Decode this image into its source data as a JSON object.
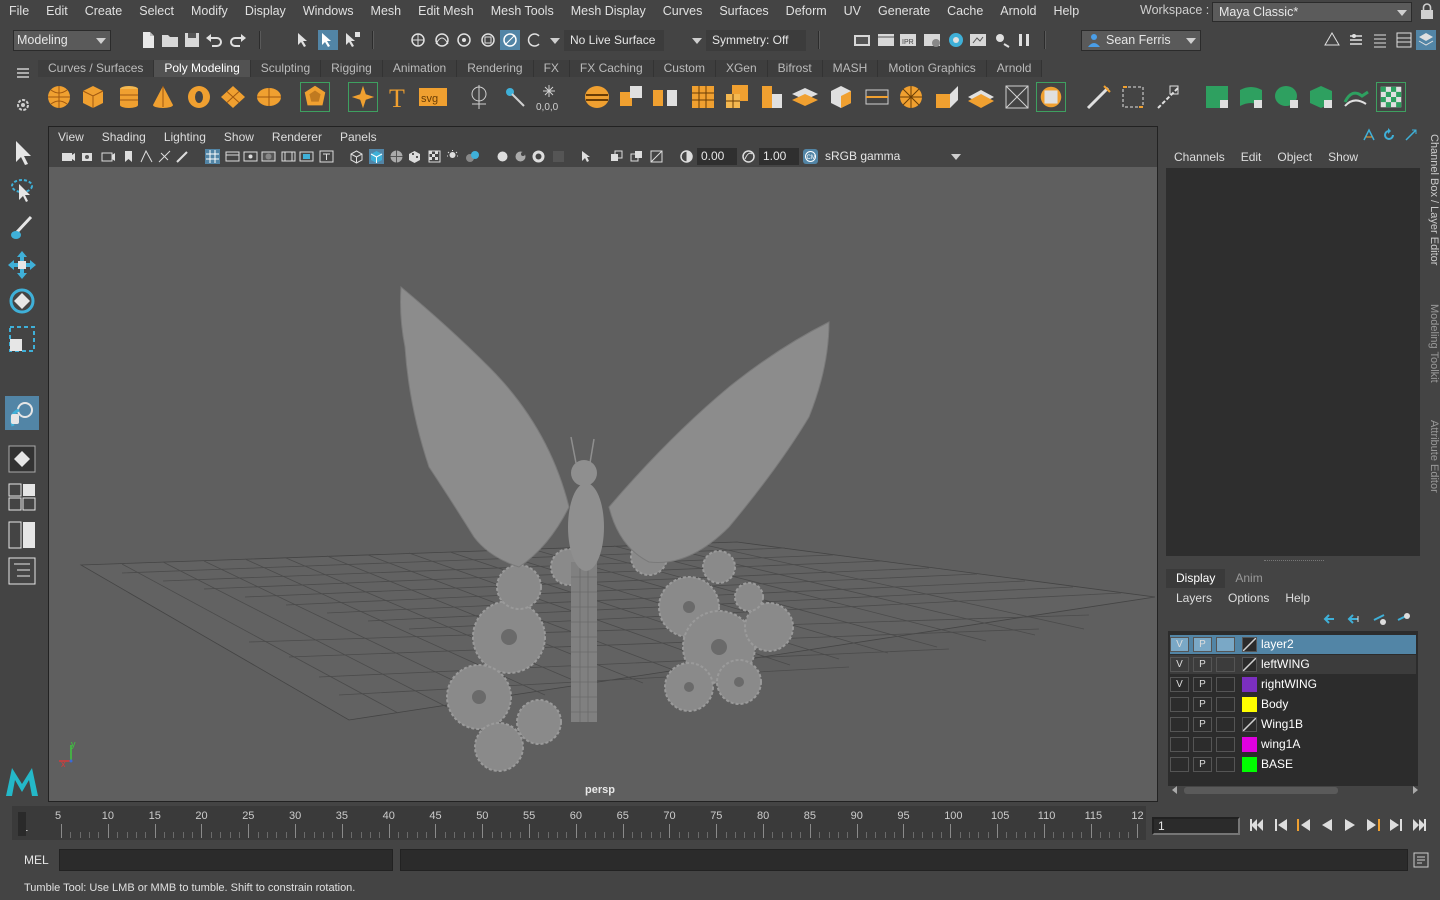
{
  "menubar": {
    "items": [
      "File",
      "Edit",
      "Create",
      "Select",
      "Modify",
      "Display",
      "Windows",
      "Mesh",
      "Edit Mesh",
      "Mesh Tools",
      "Mesh Display",
      "Curves",
      "Surfaces",
      "Deform",
      "UV",
      "Generate",
      "Cache",
      "Arnold",
      "Help"
    ],
    "workspace_label": "Workspace :",
    "workspace_value": "Maya Classic*"
  },
  "statusline": {
    "mode": "Modeling",
    "live_surface": "No Live Surface",
    "symmetry": "Symmetry: Off",
    "user": "Sean Ferris"
  },
  "shelf": {
    "tabs": [
      "Curves / Surfaces",
      "Poly Modeling",
      "Sculpting",
      "Rigging",
      "Animation",
      "Rendering",
      "FX",
      "FX Caching",
      "Custom",
      "XGen",
      "Bifrost",
      "MASH",
      "Motion Graphics",
      "Arnold"
    ],
    "active_tab": "Poly Modeling",
    "text_icon_label": "T",
    "svg_icon_label": "svg"
  },
  "viewport": {
    "menu": [
      "View",
      "Shading",
      "Lighting",
      "Show",
      "Renderer",
      "Panels"
    ],
    "exposure": "0.00",
    "gamma": "1.00",
    "color_space": "sRGB gamma",
    "camera_label": "persp",
    "axis_x": "x",
    "axis_y": "y"
  },
  "channelbox": {
    "menu": [
      "Channels",
      "Edit",
      "Object",
      "Show"
    ]
  },
  "layer_editor": {
    "tabs": [
      "Display",
      "Anim"
    ],
    "active_tab": "Display",
    "menu": [
      "Layers",
      "Options",
      "Help"
    ],
    "layers": [
      {
        "v": "V",
        "p": "P",
        "name": "layer2",
        "color": "#2b2b2b",
        "selected": true
      },
      {
        "v": "V",
        "p": "P",
        "name": "leftWING",
        "color": "#2b2b2b",
        "selected": false
      },
      {
        "v": "V",
        "p": "P",
        "name": "rightWING",
        "color": "#7b2fbf",
        "selected": false
      },
      {
        "v": "",
        "p": "P",
        "name": "Body",
        "color": "#ffff00",
        "selected": false
      },
      {
        "v": "",
        "p": "P",
        "name": "Wing1B",
        "color": "#2b2b2b",
        "selected": false
      },
      {
        "v": "",
        "p": "",
        "name": "wing1A",
        "color": "#e000e0",
        "selected": false
      },
      {
        "v": "",
        "p": "P",
        "name": "BASE",
        "color": "#00ff00",
        "selected": false
      }
    ]
  },
  "side_tabs": [
    "Channel Box / Layer Editor",
    "Modeling Toolkit",
    "Attribute Editor"
  ],
  "timeslider": {
    "labels": [
      "1",
      "5",
      "10",
      "15",
      "20",
      "25",
      "30",
      "35",
      "40",
      "45",
      "50",
      "55",
      "60",
      "65",
      "70",
      "75",
      "80",
      "85",
      "90",
      "95",
      "100",
      "105",
      "110",
      "115",
      "12"
    ],
    "current_frame": "1"
  },
  "commandline": {
    "label": "MEL"
  },
  "helpline": {
    "text": "Tumble Tool: Use LMB or MMB to tumble. Shift to constrain rotation."
  },
  "colors": {
    "accent": "#5285a6",
    "selected_row": "#5285a6",
    "viewport_bg": "#5f5f5f"
  }
}
